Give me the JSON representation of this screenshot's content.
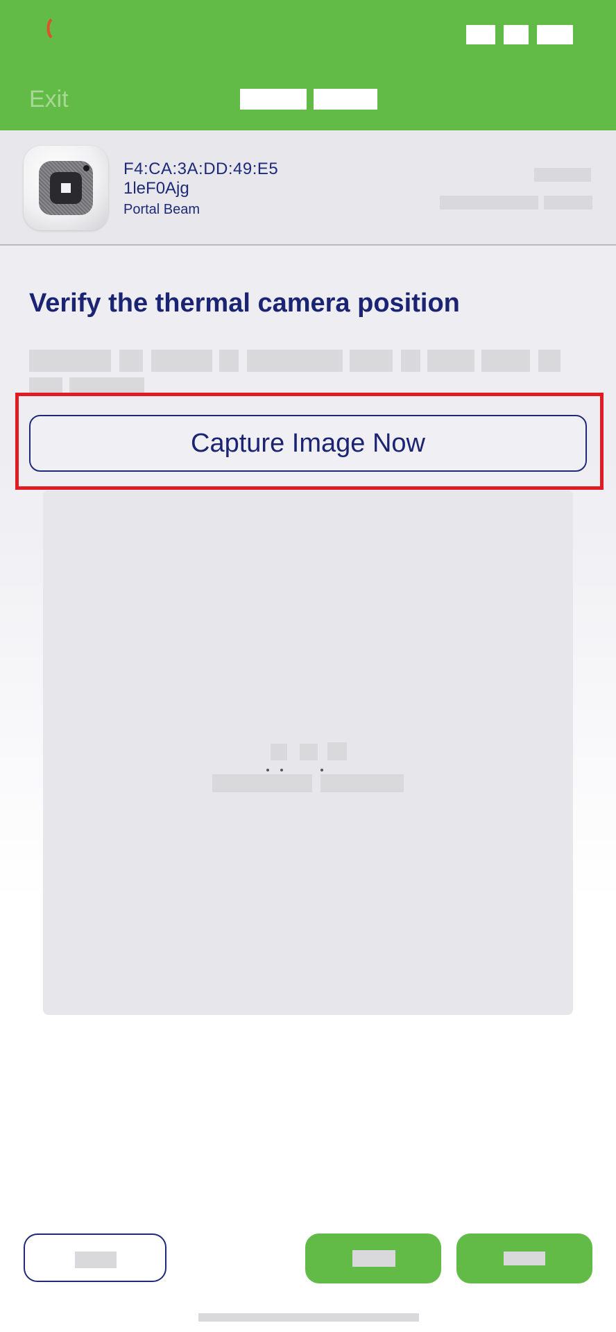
{
  "header": {
    "exit_label": "Exit",
    "background_color": "#62bb46"
  },
  "device": {
    "mac_address": "F4:CA:3A:DD:49:E5",
    "serial": "1leF0Ajg",
    "model": "Portal Beam"
  },
  "main": {
    "title": "Verify the thermal camera position",
    "capture_button_label": "Capture Image Now"
  },
  "colors": {
    "accent_green": "#62bb46",
    "navy_text": "#1a2472",
    "highlight_red": "#e11b22"
  }
}
